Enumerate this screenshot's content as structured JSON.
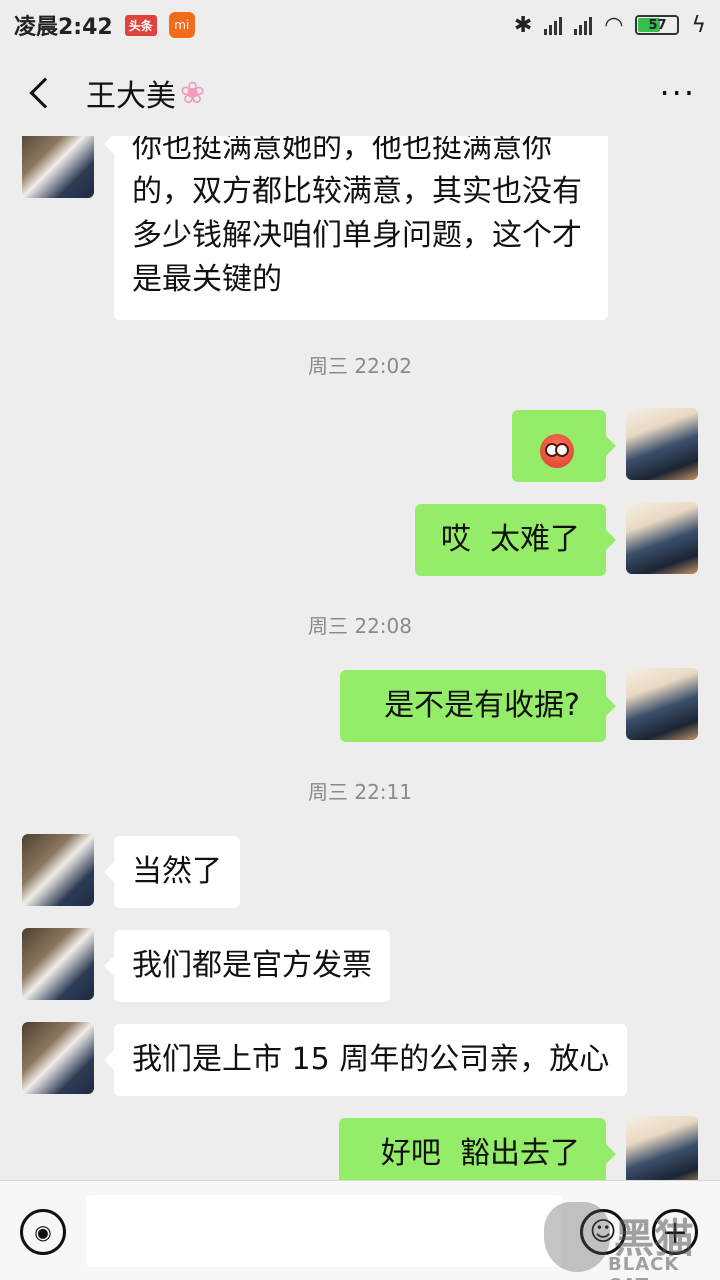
{
  "status_bar": {
    "time": "凌晨2:42",
    "toutiao_badge": "头条",
    "mi_label": "mi",
    "battery": "57"
  },
  "header": {
    "title": "王大美",
    "title_icon": "cherry-blossom-icon"
  },
  "messages": [
    {
      "id": "m1",
      "side": "in",
      "text": "你也挺满意她的，他也挺满意你的，双方都比较满意，其实也没有多少钱解决咱们单身问题，这个才是最关键的"
    },
    {
      "id": "t1",
      "type": "timestamp",
      "text": "周三 22:02"
    },
    {
      "id": "m2",
      "side": "out",
      "emoji": "flushed-face-icon"
    },
    {
      "id": "m3",
      "side": "out",
      "text": "哎  太难了"
    },
    {
      "id": "t2",
      "type": "timestamp",
      "text": "周三 22:08"
    },
    {
      "id": "m4",
      "side": "out",
      "text": "是不是有收据?"
    },
    {
      "id": "t3",
      "type": "timestamp",
      "text": "周三 22:11"
    },
    {
      "id": "m5",
      "side": "in",
      "text": "当然了"
    },
    {
      "id": "m6",
      "side": "in",
      "text": "我们都是官方发票"
    },
    {
      "id": "m7",
      "side": "in",
      "text": "我们是上市 15 周年的公司亲，放心"
    },
    {
      "id": "m8",
      "side": "out",
      "text": "好吧  豁出去了"
    }
  ],
  "input": {
    "placeholder": ""
  },
  "watermark": {
    "cn": "黑猫",
    "en": "BLACK CAT"
  }
}
